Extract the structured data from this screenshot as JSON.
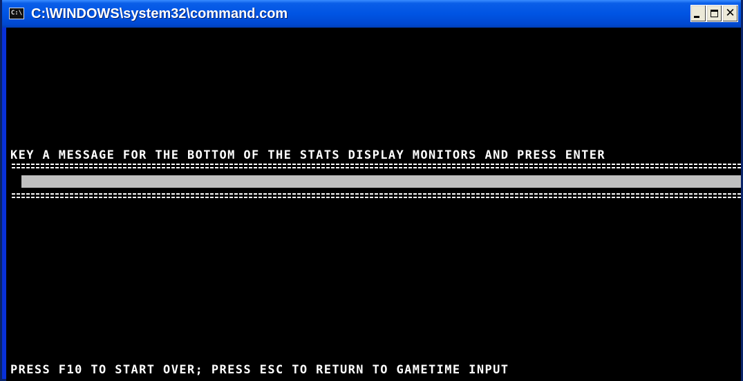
{
  "window": {
    "title": "C:\\WINDOWS\\system32\\command.com",
    "icon": "console-window-icon",
    "icon_text": "C:\\",
    "controls": {
      "minimize": "minimize-icon",
      "maximize": "maximize-icon",
      "close": "close-icon",
      "close_glyph": "✕"
    }
  },
  "console": {
    "prompt": "KEY A MESSAGE FOR THE BOTTOM OF THE STATS DISPLAY MONITORS AND PRESS ENTER",
    "input_value": "",
    "footer": "PRESS F10 TO START OVER; PRESS ESC TO RETURN TO GAMETIME INPUT"
  },
  "colors": {
    "titlebar": "#0054e3",
    "console_bg": "#000000",
    "console_text": "#ffffff",
    "input_bg": "#c0c0c0"
  }
}
